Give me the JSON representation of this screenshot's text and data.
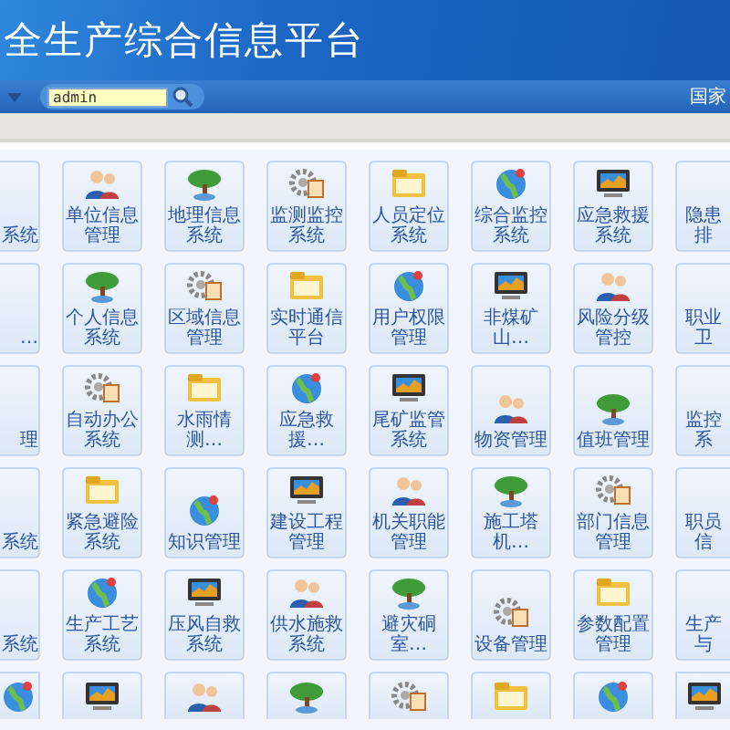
{
  "header": {
    "title": "全生产综合信息平台"
  },
  "toolbar": {
    "search": {
      "value": "admin"
    },
    "right_text": "国家"
  },
  "rows": [
    {
      "tiles": [
        {
          "kind": "left",
          "label": "系统"
        },
        {
          "kind": "full",
          "label": "单位信息管理"
        },
        {
          "kind": "full",
          "label": "地理信息系统"
        },
        {
          "kind": "full",
          "label": "监测监控系统"
        },
        {
          "kind": "full",
          "label": "人员定位系统"
        },
        {
          "kind": "full",
          "label": "综合监控系统"
        },
        {
          "kind": "full",
          "label": "应急救援系统"
        },
        {
          "kind": "right",
          "label": "隐患排"
        }
      ]
    },
    {
      "tiles": [
        {
          "kind": "left",
          "label": "…"
        },
        {
          "kind": "full",
          "label": "个人信息系统"
        },
        {
          "kind": "full",
          "label": "区域信息管理"
        },
        {
          "kind": "full",
          "label": "实时通信平台"
        },
        {
          "kind": "full",
          "label": "用户权限管理"
        },
        {
          "kind": "full",
          "label": "非煤矿山…"
        },
        {
          "kind": "full",
          "label": "风险分级管控"
        },
        {
          "kind": "right",
          "label": "职业卫"
        }
      ]
    },
    {
      "tiles": [
        {
          "kind": "left",
          "label": "理"
        },
        {
          "kind": "full",
          "label": "自动办公系统"
        },
        {
          "kind": "full",
          "label": "水雨情测…"
        },
        {
          "kind": "full",
          "label": "应急救援…"
        },
        {
          "kind": "full",
          "label": "尾矿监管系统"
        },
        {
          "kind": "full",
          "label": "物资管理"
        },
        {
          "kind": "full",
          "label": "值班管理"
        },
        {
          "kind": "right",
          "label": "监控系"
        }
      ]
    },
    {
      "tiles": [
        {
          "kind": "left",
          "label": "系统"
        },
        {
          "kind": "full",
          "label": "紧急避险系统"
        },
        {
          "kind": "full",
          "label": "知识管理"
        },
        {
          "kind": "full",
          "label": "建设工程管理"
        },
        {
          "kind": "full",
          "label": "机关职能管理"
        },
        {
          "kind": "full",
          "label": "施工塔机…"
        },
        {
          "kind": "full",
          "label": "部门信息管理"
        },
        {
          "kind": "right",
          "label": "职员信"
        }
      ]
    },
    {
      "tiles": [
        {
          "kind": "left",
          "label": "系统"
        },
        {
          "kind": "full",
          "label": "生产工艺系统"
        },
        {
          "kind": "full",
          "label": "压风自救系统"
        },
        {
          "kind": "full",
          "label": "供水施救系统"
        },
        {
          "kind": "full",
          "label": "避灾硐室…"
        },
        {
          "kind": "full",
          "label": "设备管理"
        },
        {
          "kind": "full",
          "label": "参数配置管理"
        },
        {
          "kind": "right",
          "label": "生产与"
        }
      ]
    },
    {
      "tiles": [
        {
          "kind": "left"
        },
        {
          "kind": "full"
        },
        {
          "kind": "full"
        },
        {
          "kind": "full"
        },
        {
          "kind": "full"
        },
        {
          "kind": "full"
        },
        {
          "kind": "full"
        },
        {
          "kind": "right"
        }
      ]
    }
  ]
}
